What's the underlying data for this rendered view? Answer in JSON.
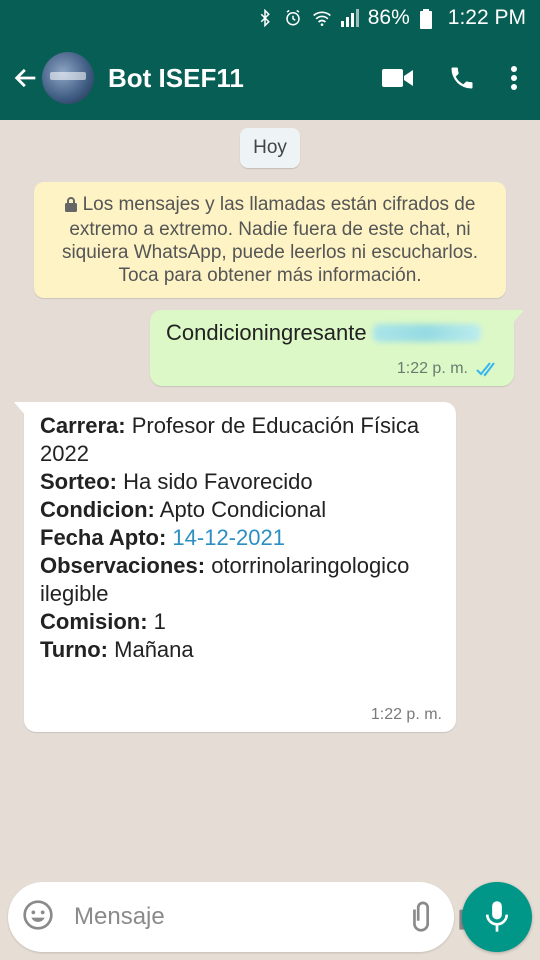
{
  "status_bar": {
    "battery_percent": "86%",
    "time": "1:22 PM",
    "icons": [
      "bluetooth-icon",
      "alarm-icon",
      "wifi-icon",
      "signal-icon",
      "battery-icon"
    ]
  },
  "header": {
    "title": "Bot ISEF11",
    "icons": [
      "back-arrow-icon",
      "video-call-icon",
      "phone-icon",
      "more-vert-icon"
    ]
  },
  "chat": {
    "date_chip": "Hoy",
    "encryption_notice": "Los mensajes y las llamadas están cifrados de extremo a extremo. Nadie fuera de este chat, ni siquiera WhatsApp, puede leerlos ni escucharlos. Toca para obtener más información.",
    "outgoing": {
      "text": "Condicioningresante",
      "time": "1:22 p. m."
    },
    "incoming": {
      "lines": [
        {
          "label": "Carrera:",
          "value": " Profesor de Educación Física 2022"
        },
        {
          "label": "Sorteo:",
          "value": " Ha sido Favorecido"
        },
        {
          "label": "Condicion:",
          "value": " Apto Condicional"
        },
        {
          "label": "Fecha Apto:",
          "value": " 14-12-2021"
        },
        {
          "label": "Observaciones:",
          "value": " otorrinolaringologico ilegible"
        },
        {
          "label": "Comision:",
          "value": " 1"
        },
        {
          "label": "Turno:",
          "value": " Mañana"
        }
      ],
      "time": "1:22 p. m."
    }
  },
  "composer": {
    "placeholder": "Mensaje",
    "value": ""
  },
  "colors": {
    "header": "#075e54",
    "outgoing_bubble": "#dcf8c6",
    "incoming_bubble": "#ffffff",
    "notice_bg": "#fdf3c5",
    "link": "#2b8fc2",
    "read_ticks": "#34b7f1",
    "mic_button": "#009688"
  }
}
